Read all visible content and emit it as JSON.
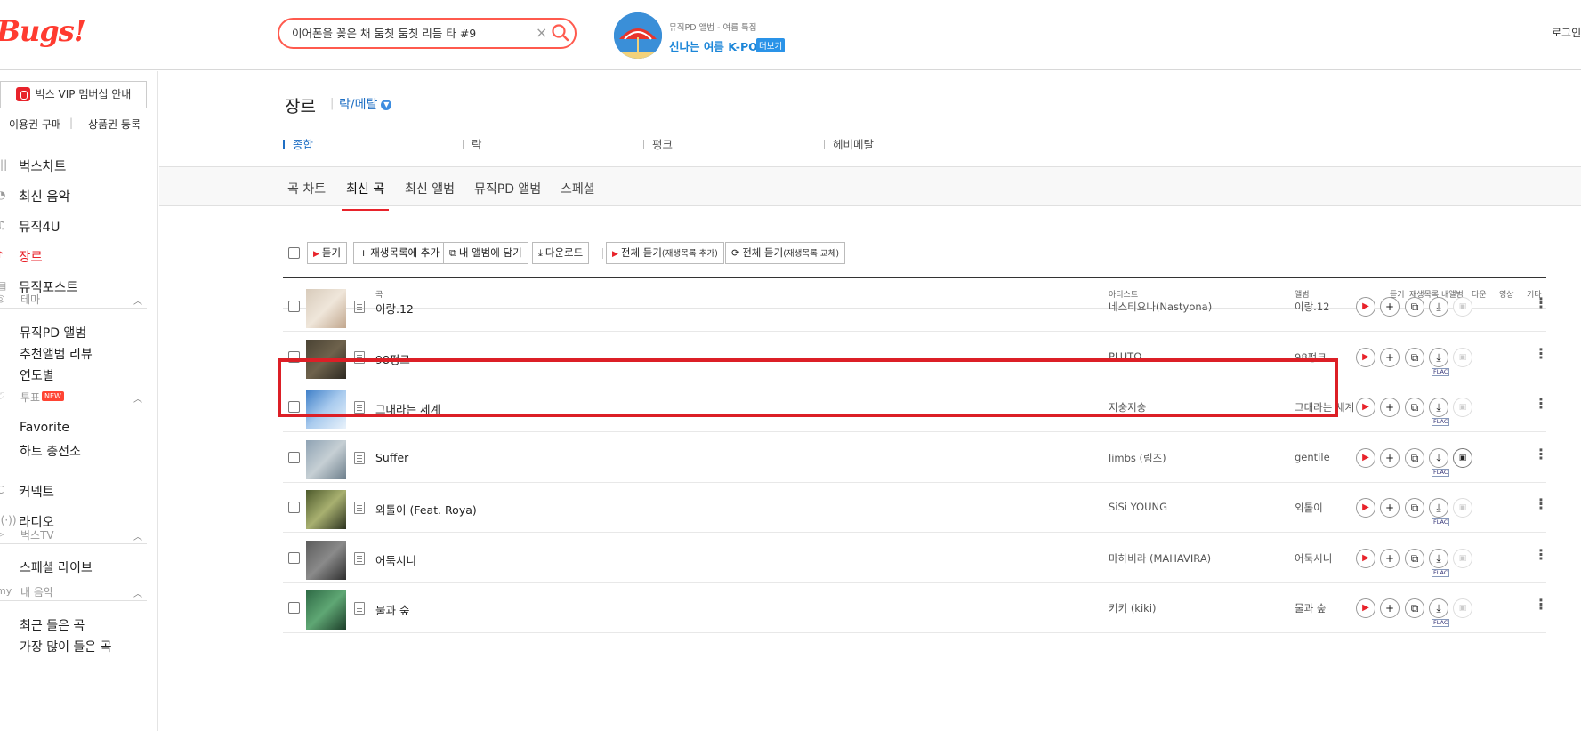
{
  "header": {
    "logo": "Bugs!",
    "search_value": "이어폰을 꽂은 채 둠칫 둠칫 리듬 타 #9",
    "promo_sub": "뮤직PD 앨범 - 여름 특집",
    "promo_title": "신나는 여름 K-POP",
    "promo_more": "더보기",
    "login": "로그인"
  },
  "sidebar": {
    "vip": "벅스 VIP 멤버십 안내",
    "buy": "이용권 구매",
    "sep": "|",
    "gift": "상품권 등록",
    "nav": [
      {
        "label": "벅스차트",
        "icon": "chart-icon"
      },
      {
        "label": "최신 음악",
        "icon": "new-music-icon"
      },
      {
        "label": "뮤직4U",
        "icon": "note-icon"
      },
      {
        "label": "장르",
        "icon": "guitar-icon"
      },
      {
        "label": "뮤직포스트",
        "icon": "post-icon"
      }
    ],
    "theme_head": "테마",
    "theme_items": [
      "뮤직PD 앨범",
      "추천앨범 리뷰",
      "연도별"
    ],
    "vote_head": "투표",
    "vote_new": "NEW",
    "vote_items": [
      "Favorite",
      "하트 충전소"
    ],
    "connect": "커넥트",
    "radio": "라디오",
    "tv_head": "벅스TV",
    "tv_items": [
      "스페셜 라이브"
    ],
    "my_head": "내 음악",
    "my_items": [
      "최근 들은 곡",
      "가장 많이 들은 곡"
    ]
  },
  "genre": {
    "title": "장르",
    "sep": "|",
    "current": "락/메탈",
    "subgenres": [
      "종합",
      "락",
      "펑크",
      "헤비메탈"
    ]
  },
  "tabs": [
    "곡 차트",
    "최신 곡",
    "최신 앨범",
    "뮤직PD 앨범",
    "스페셜"
  ],
  "toolbar": {
    "play": "듣기",
    "add_playlist": "재생목록에 추가",
    "add_album": "내 앨범에 담기",
    "download": "다운로드",
    "play_all_add": "전체 듣기",
    "play_all_add_small": "(재생목록 추가)",
    "play_all_replace": "전체 듣기",
    "play_all_replace_small": "(재생목록 교체)"
  },
  "columns": {
    "song": "곡",
    "artist": "아티스트",
    "album": "앨범",
    "listen": "듣기",
    "playlist": "재생목록",
    "my_album": "내앨범",
    "download": "다운",
    "video": "영상",
    "etc": "기타"
  },
  "flac_label": "FLAC",
  "rows": [
    {
      "title": "이랑.12",
      "artist": "네스티요나(Nastyona)",
      "album": "이랑.12",
      "flac": false,
      "video": false
    },
    {
      "title": "98펑크",
      "artist": "PLUTO",
      "album": "98펑크",
      "flac": true,
      "video": false
    },
    {
      "title": "그대라는 세계",
      "artist": "지숭지숭",
      "album": "그대라는 세계",
      "flac": true,
      "video": false
    },
    {
      "title": "Suffer",
      "artist": "limbs (림즈)",
      "album": "gentile",
      "flac": true,
      "video": true
    },
    {
      "title": "외톨이 (Feat. Roya)",
      "artist": "SiSi YOUNG",
      "album": "외톨이",
      "flac": true,
      "video": false
    },
    {
      "title": "어둑시니",
      "artist": "마하비라 (MAHAVIRA)",
      "album": "어둑시니",
      "flac": true,
      "video": false
    },
    {
      "title": "물과 숲",
      "artist": "키키 (kiki)",
      "album": "물과 숲",
      "flac": true,
      "video": false
    }
  ],
  "colors": {
    "accent": "#e8232b",
    "link": "#1f6fc4",
    "highlight_box": "#dc1f26"
  }
}
